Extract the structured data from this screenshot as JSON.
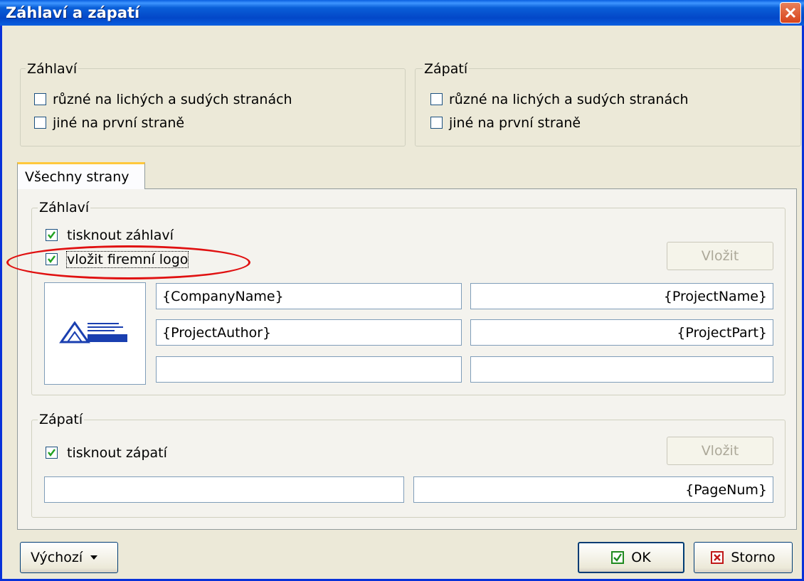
{
  "window": {
    "title": "Záhlaví a zápatí"
  },
  "top_header_group": {
    "legend": "Záhlaví",
    "odd_even_label": "různé na lichých a sudých stranách",
    "first_page_label": "jiné na první straně"
  },
  "top_footer_group": {
    "legend": "Zápatí",
    "odd_even_label": "různé na lichých a sudých stranách",
    "first_page_label": "jiné na první straně"
  },
  "tab": {
    "label": "Všechny strany"
  },
  "header_section": {
    "legend": "Záhlaví",
    "print_header_label": "tisknout záhlaví",
    "insert_logo_label": "vložit firemní logo",
    "insert_button": "Vložit",
    "left_fields": [
      "{CompanyName}",
      "{ProjectAuthor}",
      ""
    ],
    "right_fields": [
      "{ProjectName}",
      "{ProjectPart}",
      ""
    ]
  },
  "footer_section": {
    "legend": "Zápatí",
    "print_footer_label": "tisknout zápatí",
    "insert_button": "Vložit",
    "left_field": "",
    "right_field": "{PageNum}"
  },
  "buttons": {
    "default": "Výchozí",
    "ok": "OK",
    "cancel": "Storno"
  },
  "checkbox_states": {
    "top_header_odd_even": false,
    "top_header_first": false,
    "top_footer_odd_even": false,
    "top_footer_first": false,
    "print_header": true,
    "insert_logo": true,
    "print_footer": true
  },
  "icons": [
    "close-icon",
    "check-icon",
    "company-logo",
    "dropdown-arrow-icon",
    "ok-check-icon",
    "cancel-x-icon"
  ],
  "colors": {
    "titlebar": "#0a5fe0",
    "face": "#ece9d8",
    "annotation": "#e01010"
  }
}
